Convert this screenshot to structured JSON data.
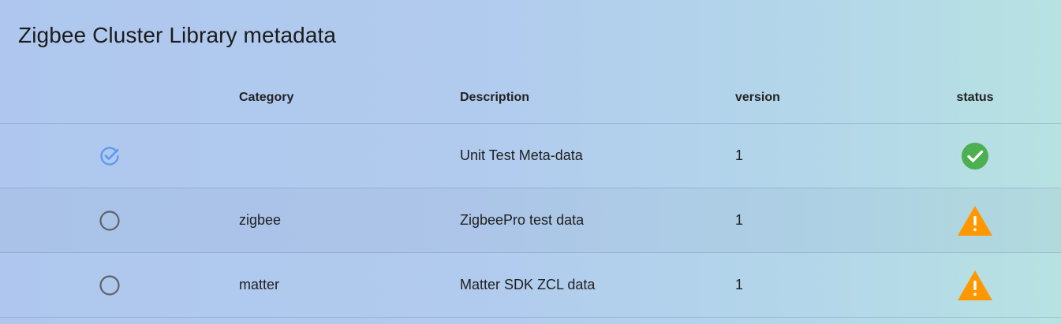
{
  "page": {
    "title": "Zigbee Cluster Library metadata"
  },
  "table": {
    "columns": {
      "select": "",
      "category": "Category",
      "description": "Description",
      "version": "version",
      "status": "status"
    },
    "rows": [
      {
        "selected": true,
        "select_icon": "check-circle-outline-icon",
        "category": "",
        "description": "Unit Test Meta-data",
        "version": "1",
        "status": "ok",
        "status_icon": "check-circle-icon"
      },
      {
        "selected": false,
        "select_icon": "radio-unchecked-icon",
        "category": "zigbee",
        "description": "ZigbeePro test data",
        "version": "1",
        "status": "warning",
        "status_icon": "warning-triangle-icon"
      },
      {
        "selected": false,
        "select_icon": "radio-unchecked-icon",
        "category": "matter",
        "description": "Matter SDK ZCL data",
        "version": "1",
        "status": "warning",
        "status_icon": "warning-triangle-icon"
      }
    ]
  },
  "colors": {
    "selected_icon": "#5a9cf0",
    "unselected_icon": "#5f6368",
    "status_ok": "#4caf50",
    "status_warning": "#ff9800"
  }
}
